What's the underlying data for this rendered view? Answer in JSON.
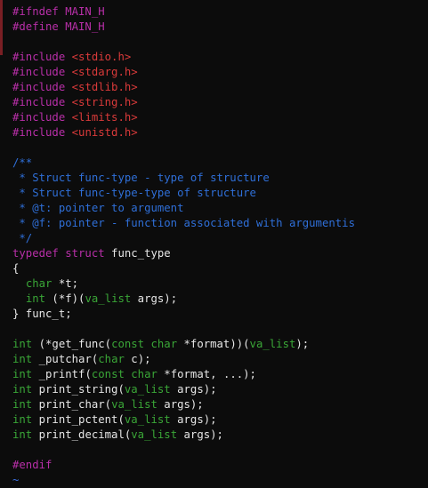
{
  "lines": [
    [
      [
        "pp",
        "#ifndef MAIN_H"
      ]
    ],
    [
      [
        "pp",
        "#define MAIN_H"
      ]
    ],
    [],
    [
      [
        "pp",
        "#include "
      ],
      [
        "str",
        "<stdio.h>"
      ]
    ],
    [
      [
        "pp",
        "#include "
      ],
      [
        "str",
        "<stdarg.h>"
      ]
    ],
    [
      [
        "pp",
        "#include "
      ],
      [
        "str",
        "<stdlib.h>"
      ]
    ],
    [
      [
        "pp",
        "#include "
      ],
      [
        "str",
        "<string.h>"
      ]
    ],
    [
      [
        "pp",
        "#include "
      ],
      [
        "str",
        "<limits.h>"
      ]
    ],
    [
      [
        "pp",
        "#include "
      ],
      [
        "str",
        "<unistd.h>"
      ]
    ],
    [],
    [
      [
        "cmt",
        "/**"
      ]
    ],
    [
      [
        "cmt",
        " * Struct func-type - type of structure"
      ]
    ],
    [
      [
        "cmt",
        " * Struct func-type-type of structure"
      ]
    ],
    [
      [
        "cmt",
        " * @t: pointer to argument"
      ]
    ],
    [
      [
        "cmt",
        " * @f: pointer - function associated with argumentis"
      ]
    ],
    [
      [
        "cmt",
        " */"
      ]
    ],
    [
      [
        "kw",
        "typedef struct"
      ],
      [
        "tx",
        " func_type"
      ]
    ],
    [
      [
        "tx",
        "{"
      ]
    ],
    [
      [
        "tx",
        "  "
      ],
      [
        "ty",
        "char"
      ],
      [
        "tx",
        " *t;"
      ]
    ],
    [
      [
        "tx",
        "  "
      ],
      [
        "ty",
        "int"
      ],
      [
        "tx",
        " (*f)("
      ],
      [
        "ty",
        "va_list"
      ],
      [
        "tx",
        " args);"
      ]
    ],
    [
      [
        "tx",
        "} func_t;"
      ]
    ],
    [],
    [
      [
        "ty",
        "int"
      ],
      [
        "tx",
        " (*get_func("
      ],
      [
        "ty",
        "const char"
      ],
      [
        "tx",
        " *format))("
      ],
      [
        "ty",
        "va_list"
      ],
      [
        "tx",
        ");"
      ]
    ],
    [
      [
        "ty",
        "int"
      ],
      [
        "tx",
        " _putchar("
      ],
      [
        "ty",
        "char"
      ],
      [
        "tx",
        " c);"
      ]
    ],
    [
      [
        "ty",
        "int"
      ],
      [
        "tx",
        " _printf("
      ],
      [
        "ty",
        "const char"
      ],
      [
        "tx",
        " *format, ...);"
      ]
    ],
    [
      [
        "ty",
        "int"
      ],
      [
        "tx",
        " print_string("
      ],
      [
        "ty",
        "va_list"
      ],
      [
        "tx",
        " args);"
      ]
    ],
    [
      [
        "ty",
        "int"
      ],
      [
        "tx",
        " print_char("
      ],
      [
        "ty",
        "va_list"
      ],
      [
        "tx",
        " args);"
      ]
    ],
    [
      [
        "ty",
        "int"
      ],
      [
        "tx",
        " print_pctent("
      ],
      [
        "ty",
        "va_list"
      ],
      [
        "tx",
        " args);"
      ]
    ],
    [
      [
        "ty",
        "int"
      ],
      [
        "tx",
        " print_decimal("
      ],
      [
        "ty",
        "va_list"
      ],
      [
        "tx",
        " args);"
      ]
    ],
    [],
    [
      [
        "pp",
        "#endif"
      ]
    ],
    [
      [
        "tilde",
        "~"
      ]
    ]
  ],
  "colors": {
    "background": "#0c0c0c",
    "preprocessor": "#b82fa8",
    "header_string": "#d93a3a",
    "comment": "#2f6fd8",
    "type": "#3aa637",
    "text": "#e6e6e6",
    "tilde": "#3b6fe0"
  }
}
